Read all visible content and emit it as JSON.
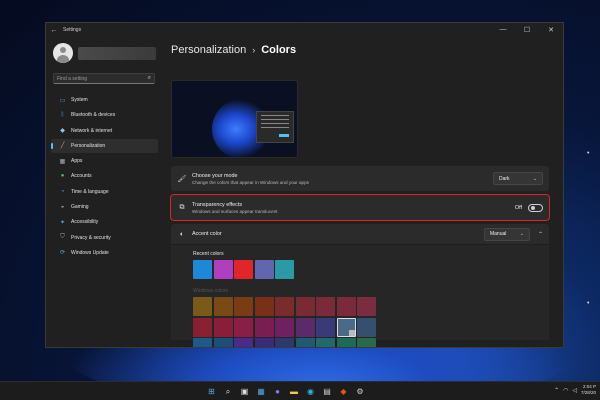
{
  "window": {
    "title": "Settings",
    "back_icon": "back-arrow-icon",
    "controls": {
      "minimize": "—",
      "maximize": "☐",
      "close": "✕"
    }
  },
  "sidebar": {
    "search_placeholder": "Find a setting",
    "items": [
      {
        "label": "System",
        "icon": "monitor-icon",
        "color": "#4fa6e8"
      },
      {
        "label": "Bluetooth & devices",
        "icon": "bluetooth-icon",
        "color": "#4fa6e8"
      },
      {
        "label": "Network & internet",
        "icon": "wifi-icon",
        "color": "#8fc8f0"
      },
      {
        "label": "Personalization",
        "icon": "brush-icon",
        "color": "#e8a070",
        "active": true
      },
      {
        "label": "Apps",
        "icon": "apps-icon",
        "color": "#a8b0c0"
      },
      {
        "label": "Accounts",
        "icon": "person-icon",
        "color": "#52c07a"
      },
      {
        "label": "Time & language",
        "icon": "globe-clock-icon",
        "color": "#4fa6e8"
      },
      {
        "label": "Gaming",
        "icon": "gamepad-icon",
        "color": "#a8b0c0"
      },
      {
        "label": "Accessibility",
        "icon": "accessibility-icon",
        "color": "#4fa6e8"
      },
      {
        "label": "Privacy & security",
        "icon": "shield-icon",
        "color": "#a8b0c0"
      },
      {
        "label": "Windows Update",
        "icon": "update-icon",
        "color": "#4fa6e8"
      }
    ]
  },
  "header": {
    "parent": "Personalization",
    "separator": "›",
    "current": "Colors"
  },
  "mode": {
    "title": "Choose your mode",
    "description": "Change the colors that appear in Windows and your apps",
    "value": "Dark"
  },
  "transparency": {
    "title": "Transparency effects",
    "description": "Windows and surfaces appear translucent",
    "state_label": "Off",
    "enabled": false
  },
  "accent": {
    "title": "Accent color",
    "value": "Manual",
    "recent_title": "Recent colors",
    "recent_colors": [
      "#1e88d8",
      "#b03fbf",
      "#e0262a",
      "#6266b0",
      "#2a9aa6"
    ],
    "windows_title": "Windows colors",
    "windows_colors": [
      "#7a5a18",
      "#7a4a14",
      "#7a3c14",
      "#7a3018",
      "#7a2c2a",
      "#7a2a32",
      "#7a2a38",
      "#7a2a3a",
      "#7a2c40",
      "#8a2034",
      "#8a1e3a",
      "#8a1e46",
      "#7a1e52",
      "#6e2060",
      "#5a2a6a",
      "#3a3a7a",
      "#4a6a8a",
      "#34506e",
      "#1c5a8a",
      "#1c4e7a",
      "#4a2a8a",
      "#3a2a7a",
      "#2a3a6a",
      "#1e5a72",
      "#22686e",
      "#1e6a5a",
      "#2a6a4a"
    ],
    "selected_index": 16
  },
  "taskbar": {
    "icons": [
      {
        "name": "start-icon",
        "glyph": "⊞",
        "color": "#4fa6e8"
      },
      {
        "name": "search-icon",
        "glyph": "⌕",
        "color": "#e0e0e0"
      },
      {
        "name": "task-view-icon",
        "glyph": "▣",
        "color": "#e0e0e0"
      },
      {
        "name": "widgets-icon",
        "glyph": "▦",
        "color": "#4fa6e8"
      },
      {
        "name": "chat-icon",
        "glyph": "●",
        "color": "#7b83eb"
      },
      {
        "name": "file-explorer-icon",
        "glyph": "▬",
        "color": "#f2c94c"
      },
      {
        "name": "edge-icon",
        "glyph": "◉",
        "color": "#2fb6e0"
      },
      {
        "name": "store-icon",
        "glyph": "▤",
        "color": "#cfcfcf"
      },
      {
        "name": "office-icon",
        "glyph": "◆",
        "color": "#e8501c"
      },
      {
        "name": "settings-icon",
        "glyph": "⚙",
        "color": "#cfcfcf"
      }
    ],
    "tray": {
      "time": "2:04 P",
      "date": "7/28/20"
    }
  }
}
